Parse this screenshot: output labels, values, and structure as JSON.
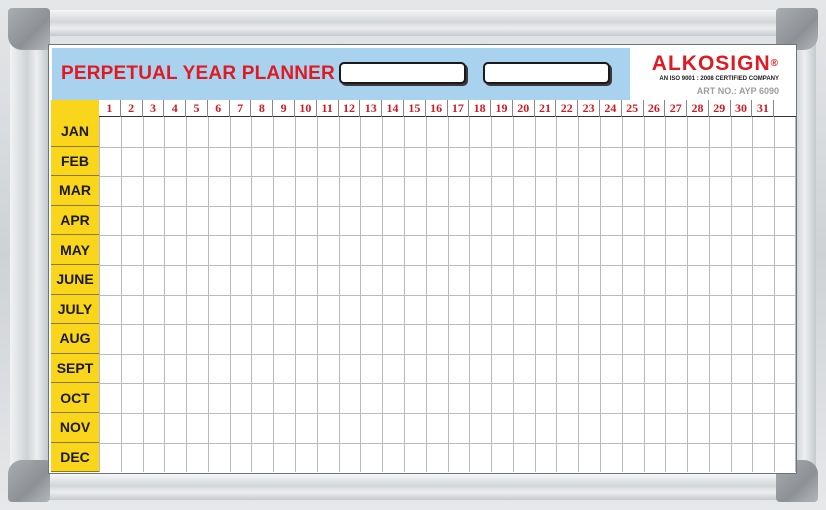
{
  "title": "PERPETUAL YEAR PLANNER",
  "brand": {
    "name": "ALKOSIGN",
    "registered": "®",
    "certification": "AN ISO 9001 : 2008 CERTIFIED COMPANY",
    "art_no": "ART NO.: AYP 6090"
  },
  "months": [
    "JAN",
    "FEB",
    "MAR",
    "APR",
    "MAY",
    "JUNE",
    "JULY",
    "AUG",
    "SEPT",
    "OCT",
    "NOV",
    "DEC"
  ],
  "days": [
    "1",
    "2",
    "3",
    "4",
    "5",
    "6",
    "7",
    "8",
    "9",
    "10",
    "11",
    "12",
    "13",
    "14",
    "15",
    "16",
    "17",
    "18",
    "19",
    "20",
    "21",
    "22",
    "23",
    "24",
    "25",
    "26",
    "27",
    "28",
    "29",
    "30",
    "31"
  ],
  "colors": {
    "title_red": "#e01a22",
    "header_blue": "#a9d2ef",
    "month_yellow": "#f9d51c",
    "grid_line": "#b9bcbf"
  }
}
